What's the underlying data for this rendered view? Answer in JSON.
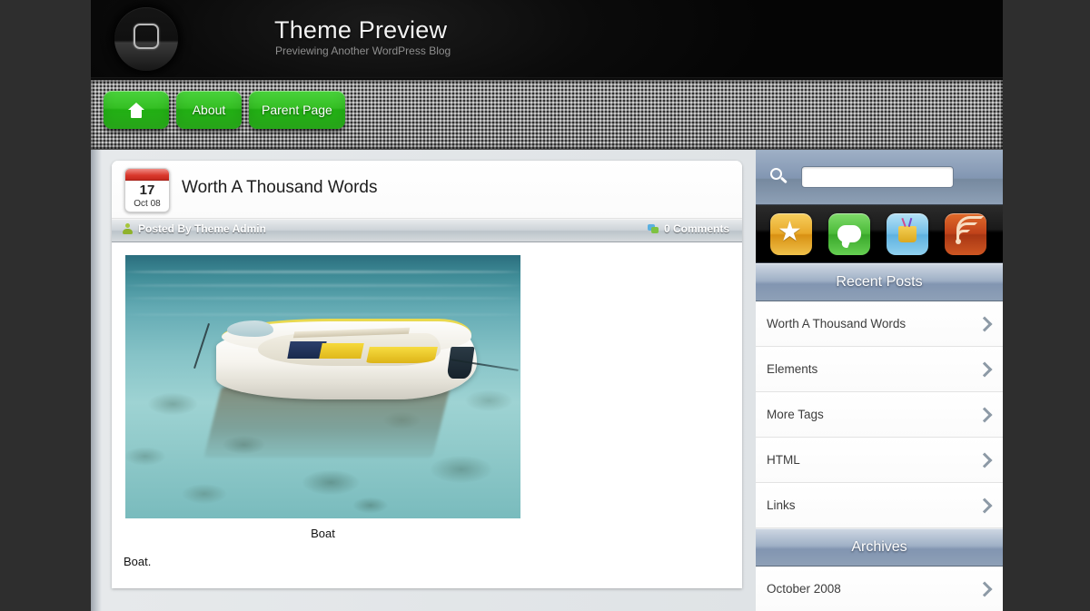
{
  "header": {
    "title": "Theme Preview",
    "description": "Previewing Another WordPress Blog",
    "logo_icon": "rounded-square-home-button-icon"
  },
  "nav": {
    "items": [
      {
        "label": "",
        "icon": "home-icon",
        "name": "nav-home"
      },
      {
        "label": "About",
        "icon": "",
        "name": "nav-about"
      },
      {
        "label": "Parent Page",
        "icon": "",
        "name": "nav-parent-page"
      }
    ]
  },
  "post": {
    "date_day": "17",
    "date_month": "Oct 08",
    "title": "Worth A Thousand Words",
    "author_meta": "Posted By Theme Admin",
    "comments_meta": "0 Comments",
    "author_icon": "user-icon",
    "comments_icon": "comment-bubbles-icon",
    "image_caption": "Boat",
    "image_alt": "white rowboat floating on clear teal water with rocks visible below",
    "body_text": "Boat."
  },
  "sidebar": {
    "search": {
      "icon": "search-icon",
      "value": "",
      "placeholder": ""
    },
    "social": [
      {
        "name": "bookmark-star-icon",
        "label": "star"
      },
      {
        "name": "comments-bubble-icon",
        "label": "chat"
      },
      {
        "name": "subscribe-bag-icon",
        "label": "bag"
      },
      {
        "name": "rss-feed-icon",
        "label": "rss"
      }
    ],
    "sections": [
      {
        "title": "Recent Posts",
        "items": [
          "Worth A Thousand Words",
          "Elements",
          "More Tags",
          "HTML",
          "Links"
        ]
      },
      {
        "title": "Archives",
        "items": [
          "October 2008"
        ]
      }
    ]
  },
  "colors": {
    "page_background": "#2e2e2e",
    "header_background": "#000000",
    "nav_button_green": "#2fbd1f",
    "sidebar_header_blue": "#8295b1",
    "content_background": "#dfe3e6",
    "calendar_red": "#d9382c"
  }
}
